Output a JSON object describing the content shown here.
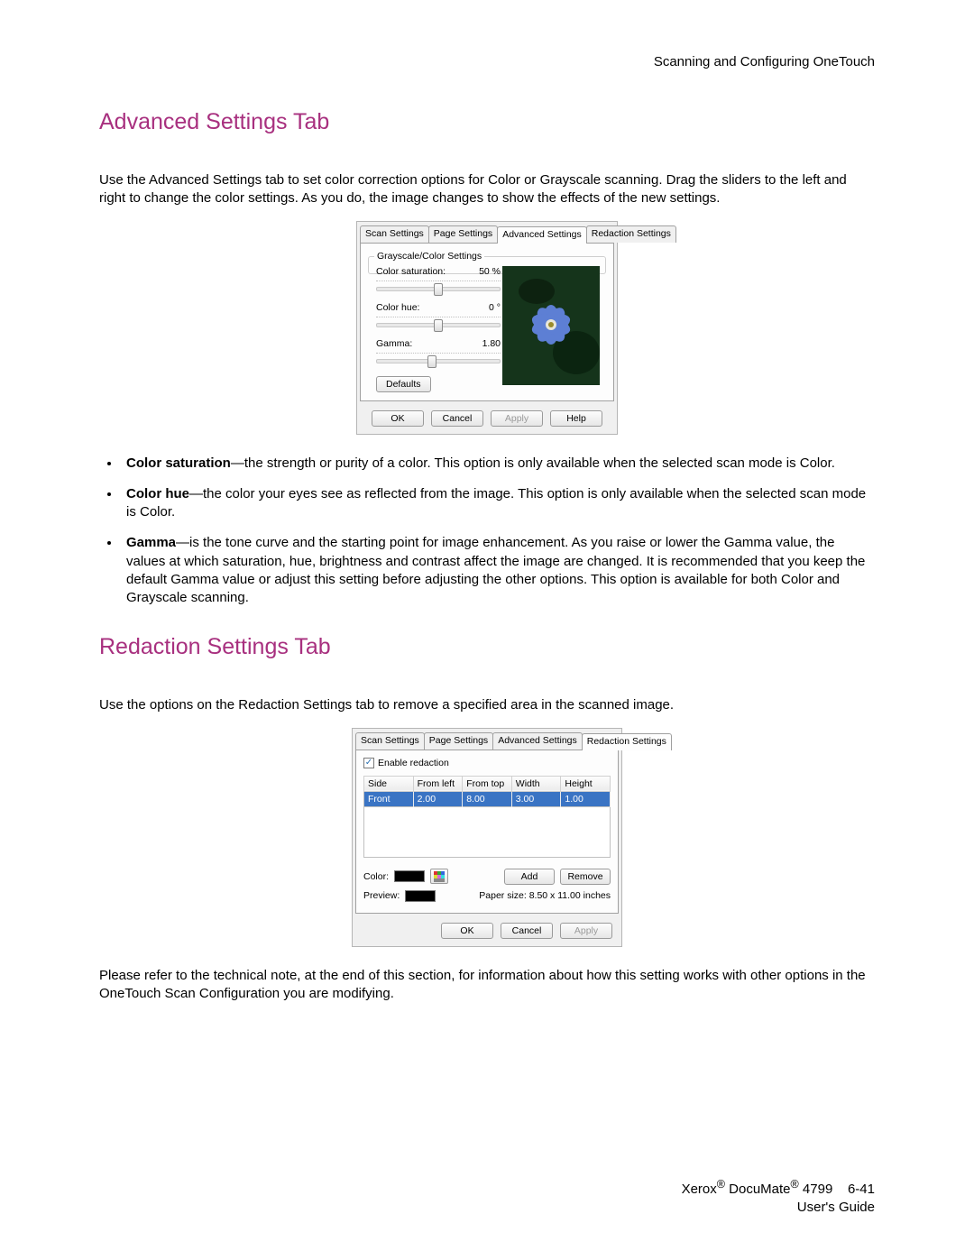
{
  "header": {
    "right": "Scanning and Configuring OneTouch"
  },
  "section1": {
    "heading": "Advanced Settings Tab",
    "intro": "Use the Advanced Settings tab to set color correction options for Color or Grayscale scanning. Drag the sliders to the left and right to change the color settings. As you do, the image changes to show the effects of the new settings."
  },
  "dlg1": {
    "tabs": [
      "Scan Settings",
      "Page Settings",
      "Advanced Settings",
      "Redaction Settings"
    ],
    "activeTabIndex": 2,
    "group_title": "Grayscale/Color Settings",
    "sliders": [
      {
        "label": "Color saturation:",
        "value": "50 %",
        "pos": 50
      },
      {
        "label": "Color hue:",
        "value": "0 °",
        "pos": 50
      },
      {
        "label": "Gamma:",
        "value": "1.80",
        "pos": 45
      }
    ],
    "defaults": "Defaults",
    "buttons": {
      "ok": "OK",
      "cancel": "Cancel",
      "apply": "Apply",
      "help": "Help"
    }
  },
  "bullets": [
    {
      "term": "Color saturation",
      "text": "—the strength or purity of a color. This option is only available when the selected scan mode is Color."
    },
    {
      "term": "Color hue",
      "text": "—the color your eyes see as reflected from the image. This option is only available when the selected scan mode is Color."
    },
    {
      "term": "Gamma",
      "text": "—is the tone curve and the starting point for image enhancement. As you raise or lower the Gamma value, the values at which saturation, hue, brightness and contrast affect the image are changed. It is recommended that you keep the default Gamma value or adjust this setting before adjusting the other options. This option is available for both Color and Grayscale scanning."
    }
  ],
  "section2": {
    "heading": "Redaction Settings Tab",
    "intro": "Use the options on the Redaction Settings tab to remove a specified area in the scanned image."
  },
  "dlg2": {
    "tabs": [
      "Scan Settings",
      "Page Settings",
      "Advanced Settings",
      "Redaction Settings"
    ],
    "activeTabIndex": 3,
    "enable_label": "Enable redaction",
    "enable_checked": true,
    "columns": [
      "Side",
      "From left",
      "From top",
      "Width",
      "Height"
    ],
    "rows": [
      {
        "side": "Front",
        "from_left": "2.00",
        "from_top": "8.00",
        "width": "3.00",
        "height": "1.00"
      }
    ],
    "color_label": "Color:",
    "add": "Add",
    "remove": "Remove",
    "preview_label": "Preview:",
    "paper_size": "Paper size:  8.50 x 11.00 inches",
    "buttons": {
      "ok": "OK",
      "cancel": "Cancel",
      "apply": "Apply"
    }
  },
  "closing": "Please refer to the technical note, at the end of this section, for information about how this setting works with other options in the OneTouch Scan Configuration you are modifying.",
  "footer": {
    "line1_prefix": "Xerox",
    "line1_mid": " DocuMate",
    "line1_suffix": " 4799",
    "pagenum": "6-41",
    "line2": "User's Guide"
  }
}
